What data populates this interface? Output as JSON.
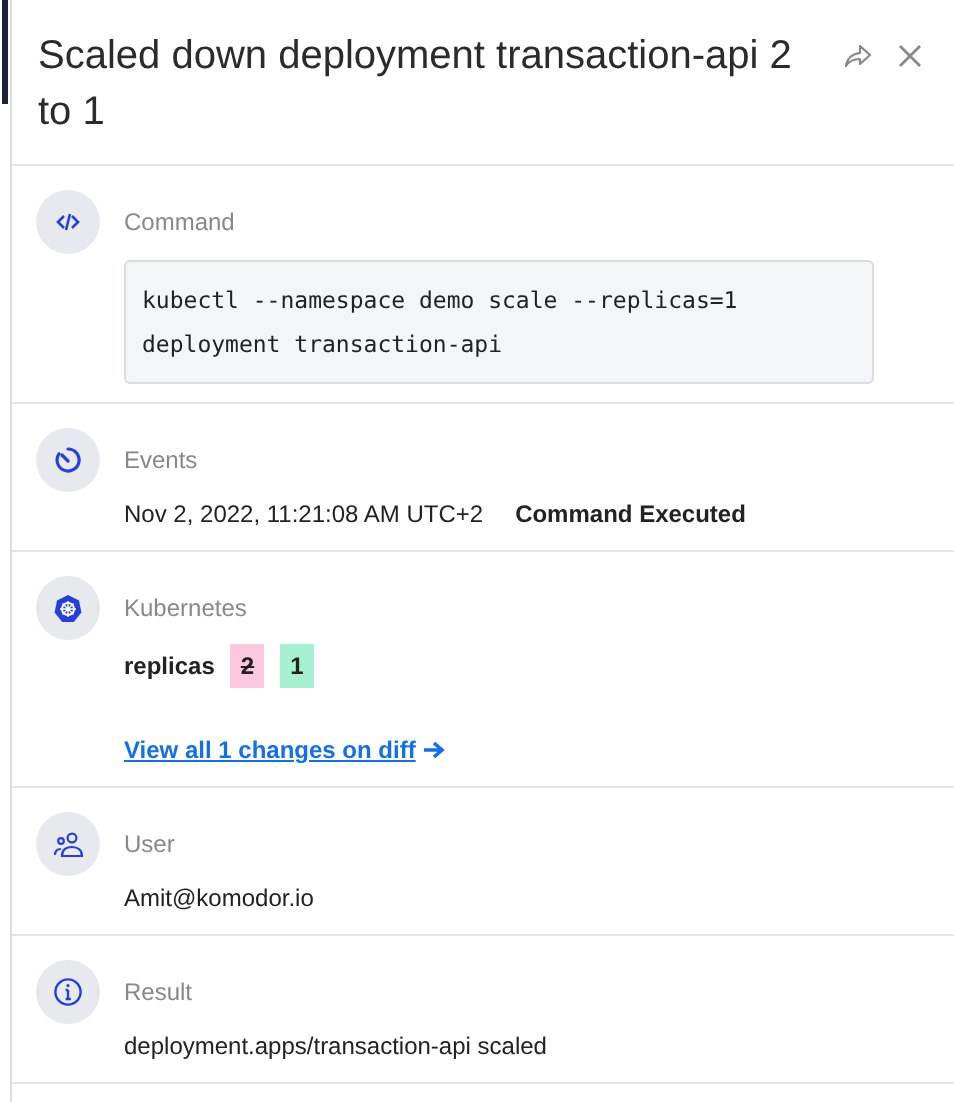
{
  "header": {
    "title": "Scaled down deployment transaction-api 2 to 1"
  },
  "sections": [
    {
      "kind": "command",
      "label": "Command",
      "lines": [
        "kubectl --namespace demo scale --replicas=1",
        "deployment transaction-api"
      ]
    },
    {
      "kind": "event",
      "label": "Events",
      "time": "Nov 2, 2022, 11:21:08 AM UTC+2",
      "status": "Command Executed"
    },
    {
      "kind": "diff",
      "label": "Kubernetes",
      "field": "replicas",
      "old": "2",
      "new": "1",
      "link": "View all 1 changes on diff"
    },
    {
      "kind": "text",
      "label": "User",
      "text": "Amit@komodor.io"
    },
    {
      "kind": "text",
      "label": "Result",
      "text": "deployment.apps/transaction-api scaled"
    }
  ]
}
